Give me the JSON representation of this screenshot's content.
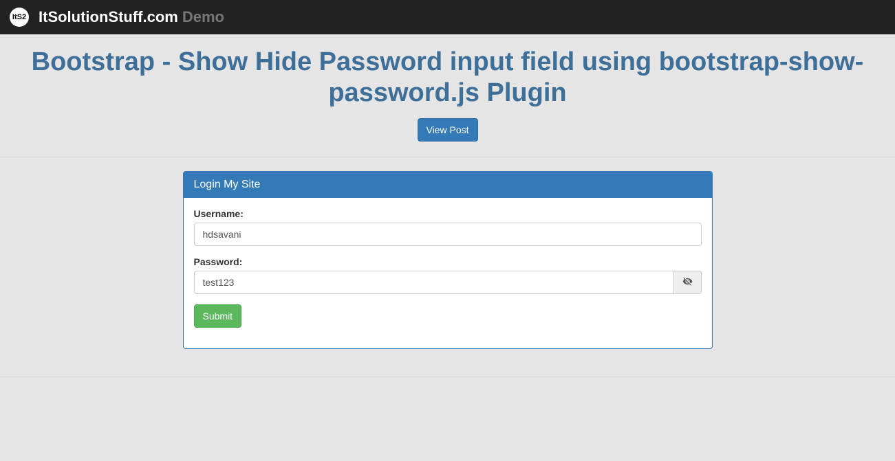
{
  "navbar": {
    "logo_text": "ItS2",
    "brand": "ItSolutionStuff.com",
    "brand_sub": "Demo"
  },
  "header": {
    "title": "Bootstrap - Show Hide Password input field using bootstrap-show-password.js Plugin",
    "view_post_label": "View Post"
  },
  "panel": {
    "heading": "Login My Site",
    "username_label": "Username:",
    "username_value": "hdsavani",
    "password_label": "Password:",
    "password_value": "test123",
    "submit_label": "Submit"
  }
}
